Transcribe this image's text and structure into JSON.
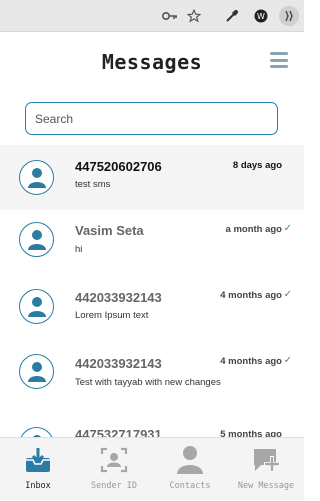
{
  "browser": {
    "icons": [
      "key-icon",
      "star-icon",
      "eyedropper-extension-icon",
      "extension-w-icon",
      "extension-puzzle-icon"
    ]
  },
  "header": {
    "title": "Messages",
    "menu_icon": "hamburger-menu-icon"
  },
  "search": {
    "placeholder": "Search",
    "value": ""
  },
  "conversations": [
    {
      "name": "447520602706",
      "preview": "test sms",
      "time": "8 days ago",
      "delivered": false,
      "active": true
    },
    {
      "name": "Vasim Seta",
      "preview": "hi",
      "time": "a month ago",
      "delivered": true,
      "active": false
    },
    {
      "name": "442033932143",
      "preview": "Lorem Ipsum text",
      "time": "4 months ago",
      "delivered": true,
      "active": false
    },
    {
      "name": "442033932143",
      "preview": "Test with tayyab with new changes",
      "time": "4 months ago",
      "delivered": true,
      "active": false
    },
    {
      "name": "447532717931",
      "preview": "",
      "time": "5 months ago",
      "delivered": true,
      "active": false
    }
  ],
  "tabs": [
    {
      "label": "Inbox",
      "icon": "inbox-download-icon",
      "active": true
    },
    {
      "label": "Sender ID",
      "icon": "face-scan-icon",
      "active": false
    },
    {
      "label": "Contacts",
      "icon": "person-icon",
      "active": false
    },
    {
      "label": "New Message",
      "icon": "message-add-icon",
      "active": false
    }
  ],
  "colors": {
    "accent": "#1f86b0",
    "check": "#2e9e4a",
    "tab_active": "#2a7ca3",
    "tab_inactive": "#a7a7a7"
  }
}
